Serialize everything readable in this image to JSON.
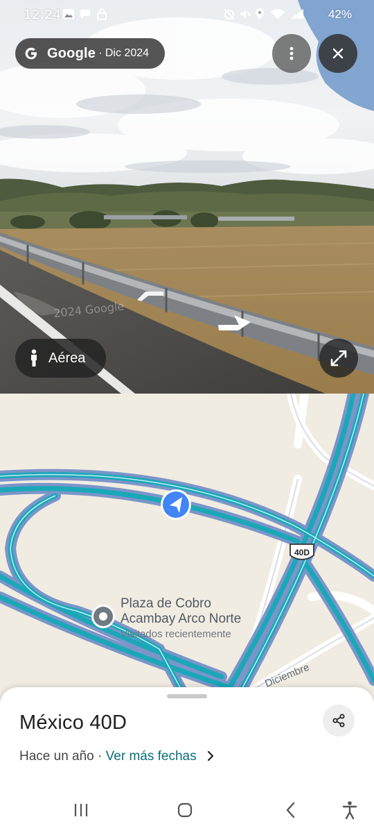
{
  "status_bar": {
    "time": "12:24",
    "battery": "42%"
  },
  "top_chip": {
    "brand": "Google",
    "date": "· Dic 2024"
  },
  "photo": {
    "watermark": "2024 Google"
  },
  "aerial_button": {
    "label": "Aérea"
  },
  "map": {
    "route_shield": "40D",
    "road_label": "Diciembre",
    "poi": {
      "name_line1": "Plaza de Cobro",
      "name_line2": "Acambay Arco Norte",
      "subtitle": "Visitados recientemente"
    }
  },
  "sheet": {
    "title": "México 40D",
    "subtitle_prefix": "Hace un año · ",
    "more_dates_link": "Ver más fechas"
  },
  "icons": [
    "google-g-icon",
    "more-vert-icon",
    "close-icon",
    "person-icon",
    "expand-icon",
    "share-icon",
    "chevron-right-icon",
    "location-arrow-icon",
    "pin-icon"
  ],
  "colors": {
    "route_teal": "#1aa8b8",
    "road_casing": "#7b95c9",
    "link_teal": "#0b6f78",
    "location_blue": "#4285f4"
  }
}
